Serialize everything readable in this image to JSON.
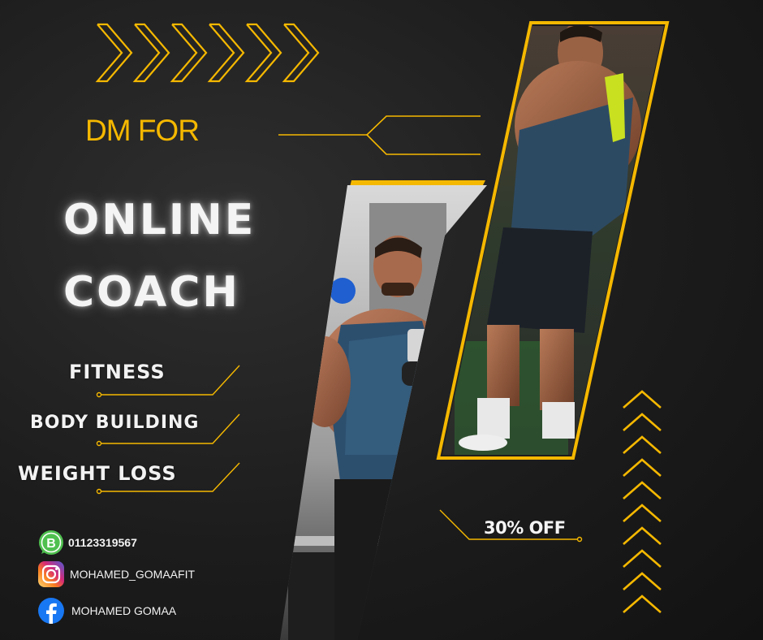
{
  "poster": {
    "intro": "DM FOR",
    "headline_line1": "ONLINE",
    "headline_line2": "COACH",
    "services": [
      "FITNESS",
      "BODY BUILDING",
      "WEIGHT LOSS"
    ],
    "offer": "30% OFF"
  },
  "contacts": {
    "whatsapp": {
      "icon": "whatsapp-business-icon",
      "label": "01123319567"
    },
    "instagram": {
      "icon": "instagram-icon",
      "label": "MOHAMED_GOMAAFIT"
    },
    "facebook": {
      "icon": "facebook-icon",
      "label": "MOHAMED GOMAA"
    }
  },
  "colors": {
    "accent": "#f5b800",
    "background": "#1c1c1c",
    "text": "#f4f4f4",
    "whatsapp": "#4fc04f",
    "facebook": "#1877f2"
  }
}
